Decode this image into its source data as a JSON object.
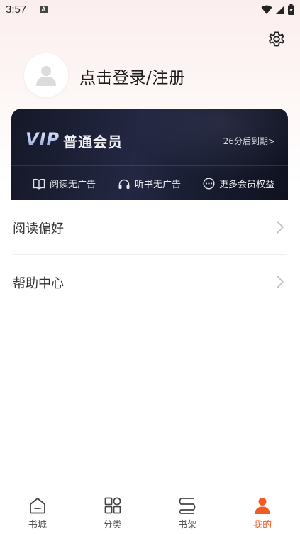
{
  "status_bar": {
    "time": "3:57",
    "a_icon_letter": "A"
  },
  "profile": {
    "login_prompt": "点击登录/注册"
  },
  "vip": {
    "logo_text": "VIP",
    "level": "普通会员",
    "expiry": "26分后到期>",
    "benefits": [
      {
        "icon": "book-icon",
        "label": "阅读无广告"
      },
      {
        "icon": "headphones-icon",
        "label": "听书无广告"
      },
      {
        "icon": "more-dots-icon",
        "label": "更多会员权益"
      }
    ]
  },
  "menu": {
    "items": [
      {
        "label": "阅读偏好",
        "icon": "chevron-right-icon"
      },
      {
        "label": "帮助中心",
        "icon": "chevron-right-icon"
      }
    ]
  },
  "bottom_nav": {
    "items": [
      {
        "label": "书城",
        "icon": "home-icon",
        "active": false
      },
      {
        "label": "分类",
        "icon": "grid-icon",
        "active": false
      },
      {
        "label": "书架",
        "icon": "bookshelf-icon",
        "active": false
      },
      {
        "label": "我的",
        "icon": "person-icon",
        "active": true
      }
    ]
  },
  "colors": {
    "accent": "#f05a24",
    "vip_card_bg": "#1b1f33"
  }
}
